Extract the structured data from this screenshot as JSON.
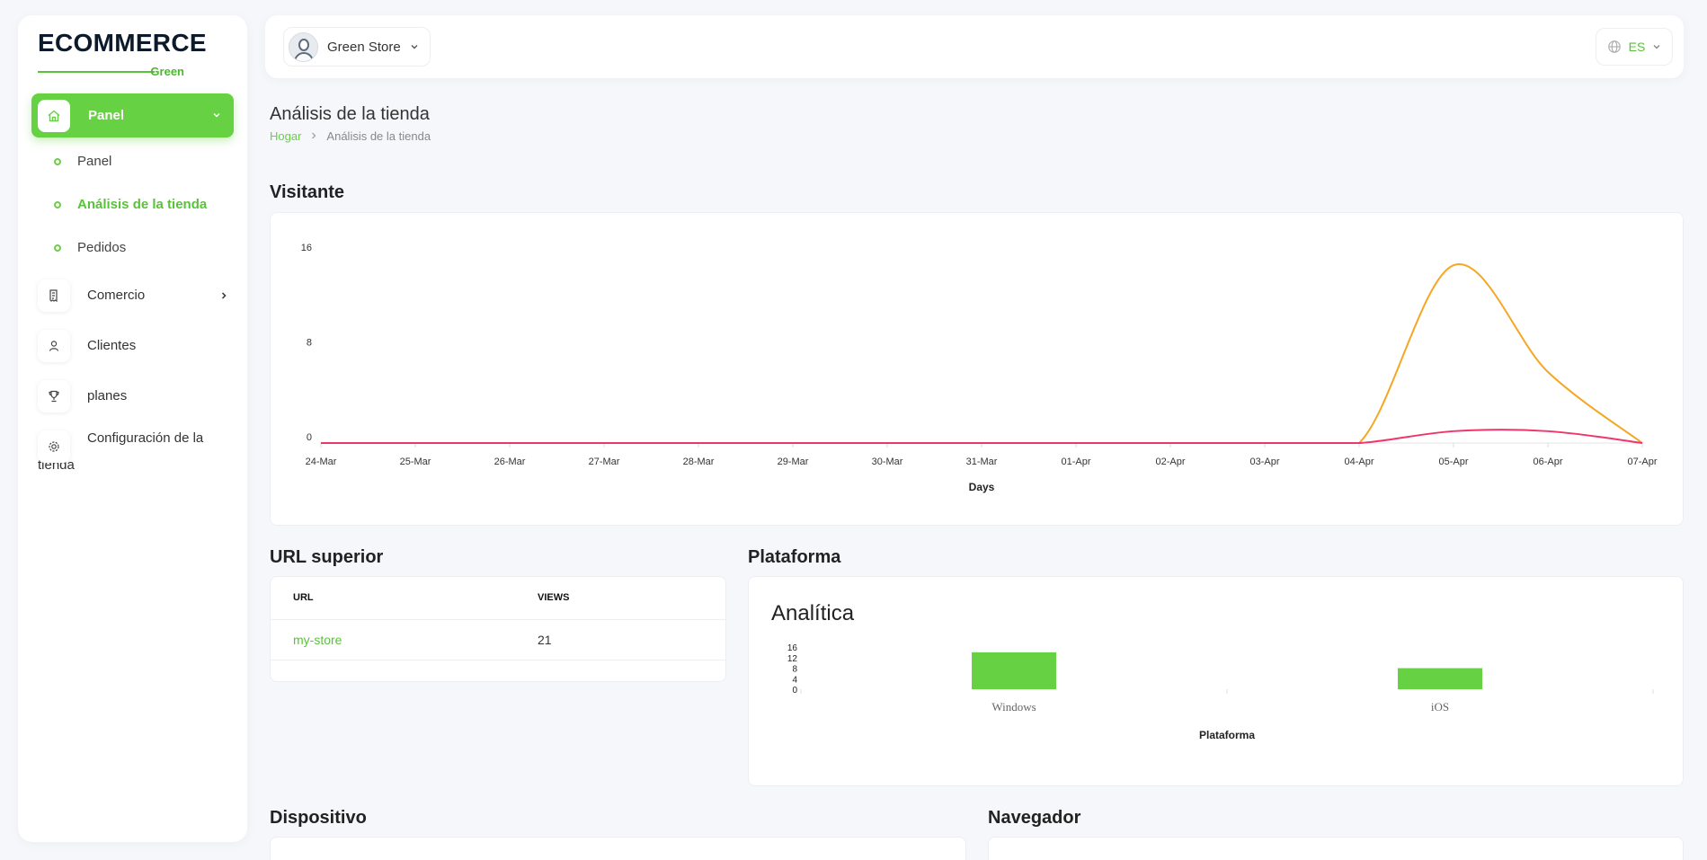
{
  "brand": {
    "name": "ECOMMERCE",
    "sub": "Green"
  },
  "sidebar": {
    "active": {
      "label": "Panel"
    },
    "submenu": [
      {
        "label": "Panel"
      },
      {
        "label": "Análisis de la tienda"
      },
      {
        "label": "Pedidos"
      }
    ],
    "items": [
      {
        "label": "Comercio",
        "icon": "receipt-icon"
      },
      {
        "label": "Clientes",
        "icon": "user-icon"
      },
      {
        "label": "planes",
        "icon": "trophy-icon"
      },
      {
        "label": "Configuración de la tienda",
        "icon": "gear-icon"
      }
    ]
  },
  "topbar": {
    "store_name": "Green Store",
    "language": "ES"
  },
  "page": {
    "title": "Análisis de la tienda",
    "breadcrumb": {
      "home": "Hogar",
      "current": "Análisis de la tienda"
    }
  },
  "sections": {
    "visitors": "Visitante",
    "top_url": "URL superior",
    "platform": "Plataforma",
    "device": "Dispositivo",
    "browser": "Navegador"
  },
  "top_url_table": {
    "headers": [
      "URL",
      "VIEWS"
    ],
    "rows": [
      {
        "url": "my-store",
        "views": "21"
      }
    ]
  },
  "colors": {
    "accent": "#66d143",
    "line_orange": "#f5a623",
    "line_pink": "#f0356b"
  },
  "chart_data": [
    {
      "type": "line",
      "xlabel": "Days",
      "ylabel": "",
      "x": [
        "24-Mar",
        "25-Mar",
        "26-Mar",
        "27-Mar",
        "28-Mar",
        "29-Mar",
        "30-Mar",
        "31-Mar",
        "01-Apr",
        "02-Apr",
        "03-Apr",
        "04-Apr",
        "05-Apr",
        "06-Apr",
        "07-Apr"
      ],
      "y_ticks": [
        0,
        8,
        16
      ],
      "ylim": [
        0,
        16
      ],
      "grid": false,
      "series": [
        {
          "color": "#f5a623",
          "values": [
            0,
            0,
            0,
            0,
            0,
            0,
            0,
            0,
            0,
            0,
            0,
            0,
            15,
            6,
            0
          ]
        },
        {
          "color": "#f0356b",
          "values": [
            0,
            0,
            0,
            0,
            0,
            0,
            0,
            0,
            0,
            0,
            0,
            0,
            1,
            1,
            0
          ]
        }
      ]
    },
    {
      "type": "bar",
      "title": "Analítica",
      "xlabel": "Plataforma",
      "categories": [
        "Windows",
        "iOS"
      ],
      "values": [
        14,
        8
      ],
      "y_ticks": [
        0,
        4,
        8,
        12,
        16
      ],
      "ylim": [
        0,
        16
      ],
      "color": "#66d143"
    }
  ]
}
